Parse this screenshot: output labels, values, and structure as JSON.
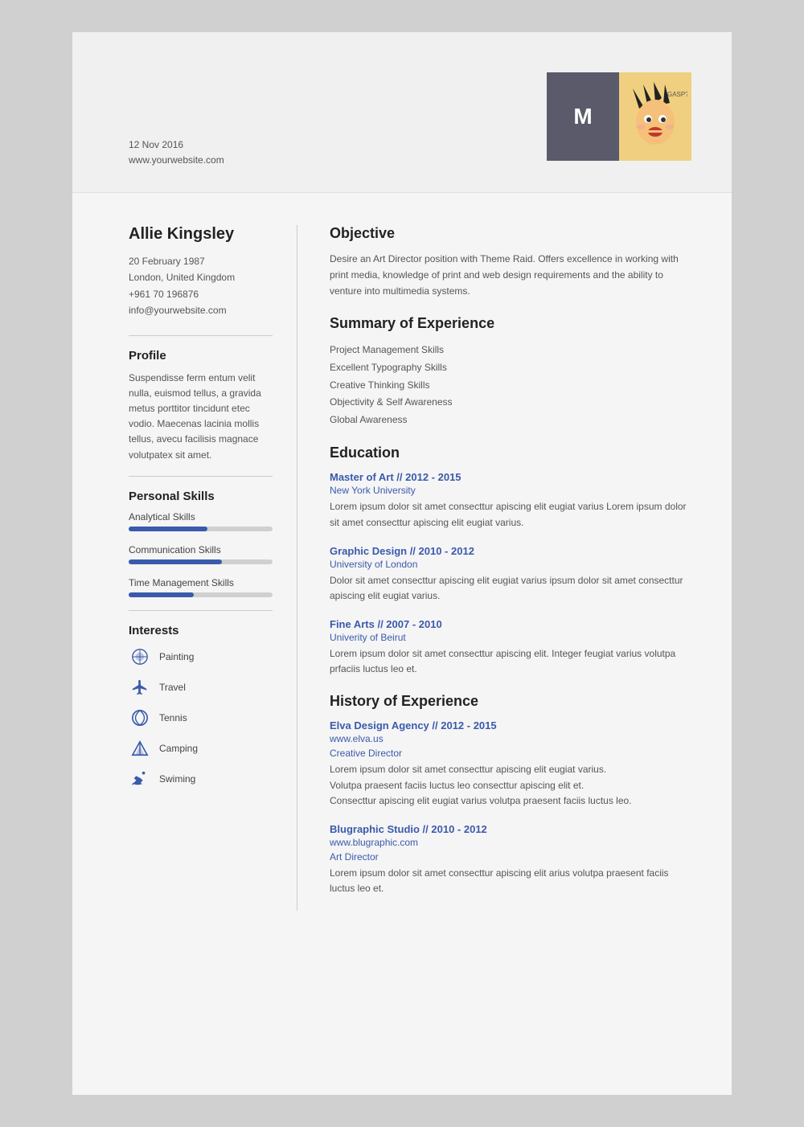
{
  "header": {
    "date": "12 Nov 2016",
    "website": "www.yourwebsite.com",
    "initial": "M"
  },
  "left": {
    "name": "Allie Kingsley",
    "contact": {
      "dob": "20 February 1987",
      "location": "London, United Kingdom",
      "phone": "+961 70 196876",
      "email": "info@yourwebsite.com"
    },
    "profile_title": "Profile",
    "profile_text": "Suspendisse ferm entum velit nulla, euismod tellus, a gravida metus porttitor tincidunt etec vodio. Maecenas lacinia mollis tellus, avecu facilisis magnace volutpatex sit amet.",
    "skills_title": "Personal Skills",
    "skills": [
      {
        "label": "Analytical Skills",
        "pct": 55
      },
      {
        "label": "Communication Skills",
        "pct": 65
      },
      {
        "label": "Time Management Skills",
        "pct": 45
      }
    ],
    "interests_title": "Interests",
    "interests": [
      {
        "label": "Painting",
        "icon": "painting"
      },
      {
        "label": "Travel",
        "icon": "travel"
      },
      {
        "label": "Tennis",
        "icon": "tennis"
      },
      {
        "label": "Camping",
        "icon": "camping"
      },
      {
        "label": "Swiming",
        "icon": "swimming"
      }
    ]
  },
  "right": {
    "objective_title": "Objective",
    "objective_text": "Desire an Art Director position with Theme Raid. Offers excellence in working with print media, knowledge of print and web design requirements and the ability to venture into multimedia systems.",
    "summary_title": "Summary of Experience",
    "summary_items": [
      "Project Management Skills",
      "Excellent Typography Skills",
      "Creative Thinking Skills",
      "Objectivity & Self Awareness",
      "Global Awareness"
    ],
    "education_title": "Education",
    "education": [
      {
        "title": "Master of Art // 2012 - 2015",
        "subtitle": "New York University",
        "body": "Lorem ipsum dolor sit amet consecttur apiscing elit eugiat varius Lorem ipsum dolor sit amet consecttur apiscing elit eugiat varius."
      },
      {
        "title": "Graphic Design // 2010 - 2012",
        "subtitle": "University of London",
        "body": "Dolor sit amet consecttur apiscing elit eugiat varius  ipsum dolor sit amet consecttur apiscing elit eugiat varius."
      },
      {
        "title": "Fine Arts // 2007 - 2010",
        "subtitle": "Univerity of Beirut",
        "body": "Lorem ipsum dolor sit amet consecttur apiscing elit. Integer feugiat varius volutpa prfaciis luctus leo et."
      }
    ],
    "history_title": "History of Experience",
    "history": [
      {
        "title": "Elva Design Agency // 2012 - 2015",
        "subtitle": "www.elva.us",
        "role": "Creative Director",
        "body": "Lorem ipsum dolor sit amet consecttur apiscing elit eugiat varius.\nVolutpa praesent faciis luctus leo consecttur apiscing elit et.\nConsecttur apiscing elit eugiat varius volutpa praesent faciis luctus leo."
      },
      {
        "title": "Blugraphic Studio // 2010 - 2012",
        "subtitle": "www.blugraphic.com",
        "role": "Art Director",
        "body": "Lorem ipsum dolor sit amet consecttur apiscing elit arius volutpa praesent faciis luctus leo et."
      }
    ]
  }
}
